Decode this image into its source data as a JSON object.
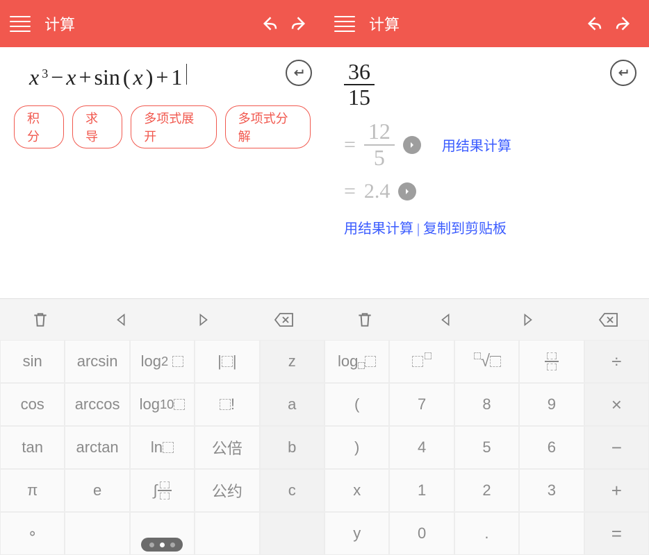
{
  "left": {
    "header": {
      "title": "计算"
    },
    "expression": {
      "x": "x",
      "exp3": "3",
      "minus": "−",
      "plus": "+",
      "sin": "sin",
      "lparen": "(",
      "rparen": ")",
      "one": "1"
    },
    "pills": [
      "积分",
      "求导",
      "多项式展开",
      "多项式分解"
    ],
    "keypad": {
      "rows": [
        [
          "sin",
          "arcsin",
          "log₂ ☐",
          "|☐|",
          "z"
        ],
        [
          "cos",
          "arccos",
          "log₁₀☐",
          "☐!",
          "a"
        ],
        [
          "tan",
          "arctan",
          "ln☐",
          "公倍",
          "b"
        ],
        [
          "π",
          "e",
          "∫☐",
          "公约",
          "c"
        ],
        [
          "∘",
          "",
          "",
          "",
          ""
        ]
      ],
      "r0": {
        "c0": "sin",
        "c1": "arcsin",
        "c4": "z"
      },
      "r1": {
        "c0": "cos",
        "c1": "arccos",
        "c4": "a"
      },
      "r2": {
        "c0": "tan",
        "c1": "arctan",
        "c2": "ln",
        "c3": "公倍",
        "c4": "b"
      },
      "r3": {
        "c0": "π",
        "c1": "e",
        "c3": "公约",
        "c4": "c"
      },
      "r4": {
        "c0": "∘"
      }
    }
  },
  "right": {
    "header": {
      "title": "计算"
    },
    "input_frac": {
      "num": "36",
      "den": "15"
    },
    "result1_frac": {
      "num": "12",
      "den": "5"
    },
    "result2": "2.4",
    "eq": "=",
    "link1": "用结果计算",
    "link2a": "用结果计算",
    "link2sep": " | ",
    "link2b": "复制到剪贴板",
    "keypad": {
      "r0": {
        "c4": "÷"
      },
      "r1": {
        "c0": "(",
        "c1": "7",
        "c2": "8",
        "c3": "9",
        "c4": "×"
      },
      "r2": {
        "c0": ")",
        "c1": "4",
        "c2": "5",
        "c3": "6",
        "c4": "−"
      },
      "r3": {
        "c0": "x",
        "c1": "1",
        "c2": "2",
        "c3": "3",
        "c4": "+"
      },
      "r4": {
        "c0": "y",
        "c1": "0",
        "c2": ".",
        "c4": "="
      }
    }
  }
}
